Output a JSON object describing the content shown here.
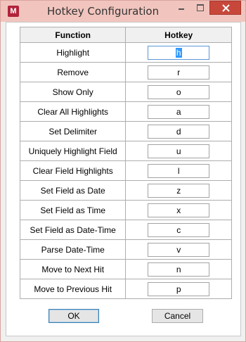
{
  "window": {
    "title": "Hotkey Configuration"
  },
  "table": {
    "headers": {
      "function": "Function",
      "hotkey": "Hotkey"
    },
    "rows": [
      {
        "function": "Highlight",
        "hotkey": "h"
      },
      {
        "function": "Remove",
        "hotkey": "r"
      },
      {
        "function": "Show Only",
        "hotkey": "o"
      },
      {
        "function": "Clear All Highlights",
        "hotkey": "a"
      },
      {
        "function": "Set Delimiter",
        "hotkey": "d"
      },
      {
        "function": "Uniquely Highlight Field",
        "hotkey": "u"
      },
      {
        "function": "Clear Field Highlights",
        "hotkey": "l"
      },
      {
        "function": "Set Field as Date",
        "hotkey": "z"
      },
      {
        "function": "Set Field as Time",
        "hotkey": "x"
      },
      {
        "function": "Set Field as Date-Time",
        "hotkey": "c"
      },
      {
        "function": "Parse Date-Time",
        "hotkey": "v"
      },
      {
        "function": "Move to Next  Hit",
        "hotkey": "n"
      },
      {
        "function": "Move to Previous Hit",
        "hotkey": "p"
      }
    ]
  },
  "buttons": {
    "ok": "OK",
    "cancel": "Cancel"
  },
  "colors": {
    "titlebar": "#f1c5be",
    "close": "#c7483b",
    "selection": "#3399ff"
  },
  "icons": {
    "app": "app-logo-icon",
    "minimize": "minimize-icon",
    "maximize": "maximize-icon",
    "close": "close-icon"
  }
}
